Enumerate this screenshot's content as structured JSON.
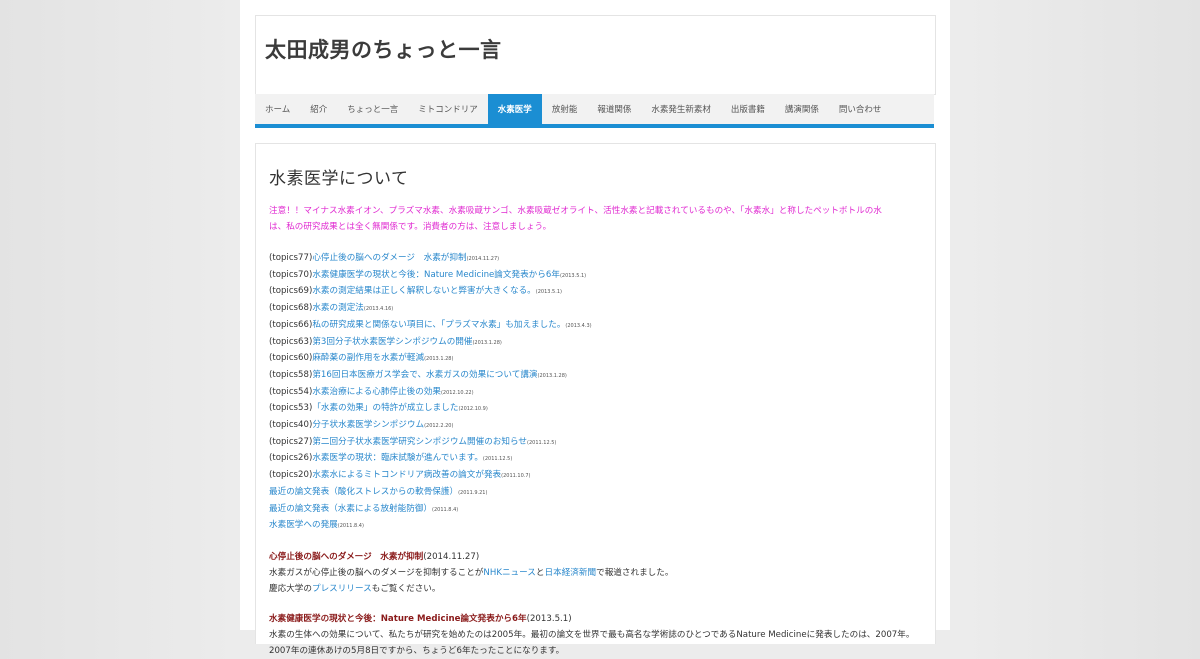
{
  "site": {
    "title": "太田成男のちょっと一言"
  },
  "nav": {
    "items": [
      {
        "label": "ホーム",
        "active": false,
        "name": "nav-home"
      },
      {
        "label": "紹介",
        "active": false,
        "name": "nav-intro"
      },
      {
        "label": "ちょっと一言",
        "active": false,
        "name": "nav-hitokoto"
      },
      {
        "label": "ミトコンドリア",
        "active": false,
        "name": "nav-mitochondria"
      },
      {
        "label": "水素医学",
        "active": true,
        "name": "nav-hydrogen-medicine"
      },
      {
        "label": "放射能",
        "active": false,
        "name": "nav-radiation"
      },
      {
        "label": "報道関係",
        "active": false,
        "name": "nav-press"
      },
      {
        "label": "水素発生新素材",
        "active": false,
        "name": "nav-hydrogen-material"
      },
      {
        "label": "出版書籍",
        "active": false,
        "name": "nav-books"
      },
      {
        "label": "講演関係",
        "active": false,
        "name": "nav-lectures"
      },
      {
        "label": "問い合わせ",
        "active": false,
        "name": "nav-contact"
      }
    ]
  },
  "main": {
    "heading": "水素医学について",
    "warning_line1": "注意！！マイナス水素イオン、プラズマ水素、水素吸蔵サンゴ、水素吸蔵ゼオライト、活性水素と記載されているものや、「水素水」と称したペットボトルの水",
    "warning_line2": "は、私の研究成果とは全く無関係です。消費者の方は、注意しましょう。",
    "topics": [
      {
        "prefix": "(topics77)",
        "link": "心停止後の脳へのダメージ　水素が抑制",
        "date": "(2014.11.27)"
      },
      {
        "prefix": "(topics70)",
        "link": "水素健康医学の現状と今後：Nature Medicine論文発表から6年",
        "date": "(2013.5.1)"
      },
      {
        "prefix": "(topics69)",
        "link": "水素の測定結果は正しく解釈しないと弊害が大きくなる。",
        "date": "(2013.5.1)"
      },
      {
        "prefix": "(topics68)",
        "link": "水素の測定法",
        "date": "(2013.4.16)"
      },
      {
        "prefix": "(topics66)",
        "link": "私の研究成果と関係ない項目に、「プラズマ水素」も加えました。",
        "date": "(2013.4.3)"
      },
      {
        "prefix": "(topics63)",
        "link": "第3回分子状水素医学シンポジウムの開催",
        "date": "(2013.1.28)"
      },
      {
        "prefix": "(topics60)",
        "link": "麻酔薬の副作用を水素が軽減",
        "date": "(2013.1.28)"
      },
      {
        "prefix": "(topics58)",
        "link": "第16回日本医療ガス学会で、水素ガスの効果について講演",
        "date": "(2013.1.28)"
      },
      {
        "prefix": "(topics54)",
        "link": "水素治療による心肺停止後の効果",
        "date": "(2012.10.22)"
      },
      {
        "prefix": "(topics53)",
        "link": "「水素の効果」の特許が成立しました",
        "date": "(2012.10.9)"
      },
      {
        "prefix": "(topics40)",
        "link": "分子状水素医学シンポジウム",
        "date": "(2012.2.20)"
      },
      {
        "prefix": "(topics27)",
        "link": "第二回分子状水素医学研究シンポジウム開催のお知らせ",
        "date": "(2011.12.5)"
      },
      {
        "prefix": "(topics26)",
        "link": "水素医学の現状：臨床試験が進んでいます。",
        "date": "(2011.12.5)"
      },
      {
        "prefix": "(topics20)",
        "link": "水素水によるミトコンドリア病改善の論文が発表",
        "date": "(2011.10.7)"
      },
      {
        "prefix": "",
        "link": "最近の論文発表（酸化ストレスからの軟骨保護）",
        "date": "(2011.9.21)"
      },
      {
        "prefix": "",
        "link": "最近の論文発表（水素による放射能防御）",
        "date": "(2011.8.4)"
      },
      {
        "prefix": "",
        "link": "水素医学への発展",
        "date": "(2011.8.4)"
      }
    ],
    "article1": {
      "title": "心停止後の脳へのダメージ　水素が抑制",
      "date": "(2014.11.27)",
      "line1_a": "水素ガスが心停止後の脳へのダメージを抑制することが",
      "link_nhk": "NHKニュース",
      "line1_b": "と",
      "link_nikkei": "日本経済新聞",
      "line1_c": "で報道されました。",
      "line2_a": "慶応大学の",
      "link_press": "プレスリリース",
      "line2_b": "もご覧ください。"
    },
    "article2": {
      "title": "水素健康医学の現状と今後：Nature Medicine論文発表から6年",
      "date": "(2013.5.1)",
      "line1": "水素の生体への効果について、私たちが研究を始めたのは2005年。最初の論文を世界で最も高名な学術誌のひとつであるNature Medicineに発表したのは、2007年。",
      "line2": "2007年の連休あけの5月8日ですから、ちょうど6年たったことになります。"
    }
  }
}
